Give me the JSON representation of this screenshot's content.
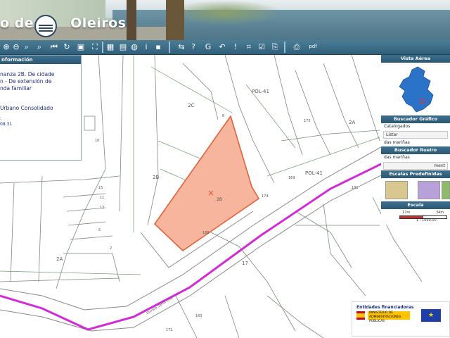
{
  "app": {
    "title_part1": "o de",
    "title_part2": "Oleiros"
  },
  "toolbar": {
    "icons": [
      "zoom-in-icon",
      "zoom-out-icon",
      "zoom-window-icon",
      "zoom-prev-icon",
      "zoom-next-icon",
      "home-icon",
      "refresh-icon",
      "extent-icon",
      "pan-icon",
      "grid-icon",
      "globe-icon",
      "info-icon",
      "identify-icon",
      "measure-icon",
      "help-icon",
      "geo-icon",
      "undo-icon",
      "alert-icon",
      "coords-icon",
      "check-icon",
      "snap-icon",
      "print-icon",
      "pdf-icon"
    ],
    "info_label": "i",
    "help_label": "?",
    "alert_label": "!",
    "pdf_label": "pdf"
  },
  "info_panel": {
    "header": "nformación",
    "text_line1": "nanza 2B. De cidade",
    "text_line2": "n - De extensión de",
    "text_line3": "nda familiar",
    "zone": "Urbano Consolidado",
    "num1": ":",
    "num2": "08.31"
  },
  "right_panel": {
    "vista_aerea": "Vista Aérea",
    "buscador_grafico": "Buscador Gráfico",
    "catalogados": "Catalogados",
    "listar": "Listar",
    "place_value": "das mariñas",
    "buscador_rueiro": "Buscador Rueiro",
    "rueiro_value": "das mariñas",
    "rueiro_btn": "ment",
    "escalas": "Escalas Predefinidas",
    "escala": "Escala",
    "scale_17m": "17m",
    "scale_34m": "34m",
    "scale_ratio": "1 : 1690.00"
  },
  "map_labels": {
    "pol41_top": "POL-41",
    "pol41_road": "POL-41",
    "z2c": "2C",
    "z2b_left": "2B",
    "z2b_parcel": "2B",
    "z2a_left": "2A",
    "z2a_right": "2A",
    "z17": "17",
    "n10": "10",
    "n15": "15",
    "n11": "11",
    "n12": "12",
    "n5": "5",
    "n2": "2",
    "n174": "174",
    "n175": "175",
    "n168": "168",
    "n171": "171",
    "n181": "181",
    "n8": "8",
    "n163": "163",
    "n169": "169",
    "road_name": "Estrada Santa Cruz"
  },
  "sponsor": {
    "title": "Entidades financiadoras",
    "ministry": "MINISTERIO DE ADMINISTRACIONES PÚBLICAS",
    "eu_stars": "★"
  },
  "colors": {
    "banner_bar": "#2f5f79",
    "panel_header": "#3d6f8d",
    "parcel_fill": "#f6b59c",
    "parcel_stroke": "#e0623b",
    "road_line": "#d22ad6",
    "parcel_lines": "#6d8b6d"
  }
}
